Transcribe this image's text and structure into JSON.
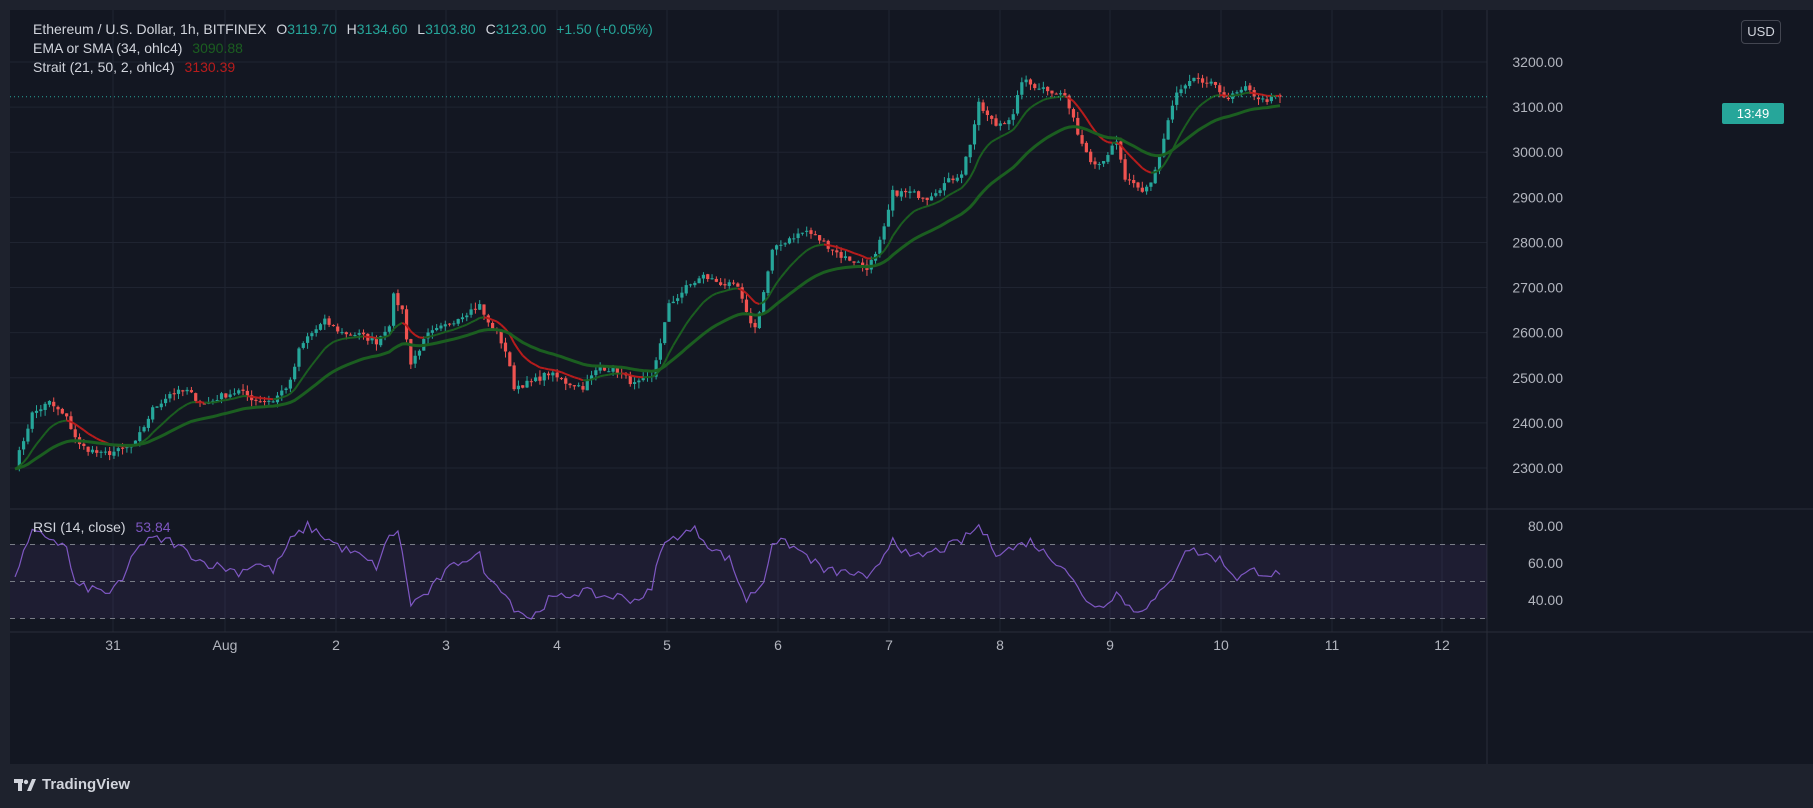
{
  "header": {
    "symbol": "Ethereum / U.S. Dollar, 1h, BITFINEX",
    "o_label": "O",
    "o_value": "3119.70",
    "h_label": "H",
    "h_value": "3134.60",
    "l_label": "L",
    "l_value": "3103.80",
    "c_label": "C",
    "c_value": "3123.00",
    "change": "+1.50 (+0.05%)"
  },
  "indicators": {
    "ema_title": "EMA or SMA (34, ohlc4)",
    "ema_value": "3090.88",
    "strait_title": "Strait (21, 50, 2, ohlc4)",
    "strait_value": "3130.39",
    "rsi_title": "RSI (14, close)",
    "rsi_value": "53.84"
  },
  "currency_label": "USD",
  "countdown": "13:49",
  "branding": {
    "name": "TradingView"
  },
  "colors": {
    "up": "#26a69a",
    "down": "#ef5350",
    "ema": "#1b5e20",
    "strait": "#b71c1c",
    "rsi": "#7e57c2",
    "background": "#131722"
  },
  "chart_data": [
    {
      "type": "candlestick",
      "title": "Ethereum / U.S. Dollar, 1h, BITFINEX",
      "x_ticks": [
        "31",
        "Aug",
        "2",
        "3",
        "4",
        "5",
        "6",
        "7",
        "8",
        "9",
        "10",
        "11",
        "12"
      ],
      "y_ticks": [
        "3200.00",
        "3100.00",
        "3000.00",
        "2900.00",
        "2800.00",
        "2700.00",
        "2600.00",
        "2500.00",
        "2400.00",
        "2300.00"
      ],
      "ylim": [
        2300,
        3200
      ],
      "last_close": 3123.0,
      "price_path": [
        [
          0,
          2305
        ],
        [
          4,
          2420
        ],
        [
          8,
          2445
        ],
        [
          12,
          2410
        ],
        [
          15,
          2350
        ],
        [
          20,
          2330
        ],
        [
          25,
          2340
        ],
        [
          28,
          2355
        ],
        [
          32,
          2430
        ],
        [
          36,
          2465
        ],
        [
          40,
          2470
        ],
        [
          44,
          2440
        ],
        [
          48,
          2460
        ],
        [
          52,
          2470
        ],
        [
          56,
          2450
        ],
        [
          60,
          2450
        ],
        [
          64,
          2490
        ],
        [
          66,
          2560
        ],
        [
          68,
          2590
        ],
        [
          72,
          2625
        ],
        [
          76,
          2600
        ],
        [
          80,
          2595
        ],
        [
          84,
          2580
        ],
        [
          87,
          2620
        ],
        [
          88,
          2680
        ],
        [
          90,
          2650
        ],
        [
          92,
          2530
        ],
        [
          94,
          2565
        ],
        [
          96,
          2595
        ],
        [
          100,
          2615
        ],
        [
          104,
          2640
        ],
        [
          108,
          2660
        ],
        [
          110,
          2620
        ],
        [
          112,
          2600
        ],
        [
          114,
          2560
        ],
        [
          116,
          2480
        ],
        [
          120,
          2490
        ],
        [
          124,
          2510
        ],
        [
          128,
          2490
        ],
        [
          132,
          2480
        ],
        [
          136,
          2525
        ],
        [
          140,
          2515
        ],
        [
          144,
          2485
        ],
        [
          148,
          2500
        ],
        [
          150,
          2580
        ],
        [
          152,
          2660
        ],
        [
          156,
          2700
        ],
        [
          160,
          2725
        ],
        [
          164,
          2710
        ],
        [
          168,
          2700
        ],
        [
          170,
          2640
        ],
        [
          172,
          2610
        ],
        [
          174,
          2690
        ],
        [
          176,
          2780
        ],
        [
          180,
          2810
        ],
        [
          184,
          2825
        ],
        [
          188,
          2800
        ],
        [
          192,
          2770
        ],
        [
          196,
          2755
        ],
        [
          198,
          2745
        ],
        [
          200,
          2770
        ],
        [
          202,
          2830
        ],
        [
          204,
          2910
        ],
        [
          208,
          2910
        ],
        [
          212,
          2900
        ],
        [
          216,
          2930
        ],
        [
          220,
          2955
        ],
        [
          222,
          3020
        ],
        [
          224,
          3105
        ],
        [
          226,
          3080
        ],
        [
          228,
          3060
        ],
        [
          232,
          3080
        ],
        [
          234,
          3160
        ],
        [
          236,
          3150
        ],
        [
          240,
          3140
        ],
        [
          244,
          3125
        ],
        [
          246,
          3070
        ],
        [
          248,
          3020
        ],
        [
          250,
          2985
        ],
        [
          252,
          2975
        ],
        [
          256,
          3020
        ],
        [
          258,
          2940
        ],
        [
          262,
          2910
        ],
        [
          264,
          2935
        ],
        [
          266,
          2990
        ],
        [
          268,
          3070
        ],
        [
          270,
          3130
        ],
        [
          274,
          3160
        ],
        [
          278,
          3150
        ],
        [
          282,
          3120
        ],
        [
          286,
          3140
        ],
        [
          290,
          3115
        ],
        [
          294,
          3123
        ]
      ],
      "series": [
        {
          "name": "EMA or SMA (34, ohlc4)",
          "last": 3090.88
        },
        {
          "name": "Strait (21, 50, 2, ohlc4)",
          "last": 3130.39
        }
      ]
    },
    {
      "type": "line",
      "title": "RSI (14, close)",
      "y_ticks": [
        "80.00",
        "60.00",
        "40.00"
      ],
      "ylim": [
        28,
        85
      ],
      "bands": [
        30,
        50,
        70
      ],
      "last": 53.84,
      "values": [
        [
          0,
          54
        ],
        [
          4,
          76
        ],
        [
          8,
          74
        ],
        [
          12,
          68
        ],
        [
          14,
          48
        ],
        [
          18,
          46
        ],
        [
          22,
          44
        ],
        [
          25,
          50
        ],
        [
          28,
          68
        ],
        [
          32,
          73
        ],
        [
          36,
          72
        ],
        [
          40,
          66
        ],
        [
          44,
          60
        ],
        [
          48,
          58
        ],
        [
          52,
          55
        ],
        [
          56,
          60
        ],
        [
          60,
          56
        ],
        [
          64,
          72
        ],
        [
          68,
          80
        ],
        [
          72,
          74
        ],
        [
          76,
          68
        ],
        [
          80,
          64
        ],
        [
          84,
          58
        ],
        [
          87,
          74
        ],
        [
          89,
          78
        ],
        [
          92,
          38
        ],
        [
          96,
          44
        ],
        [
          100,
          55
        ],
        [
          104,
          62
        ],
        [
          108,
          64
        ],
        [
          110,
          50
        ],
        [
          112,
          50
        ],
        [
          116,
          36
        ],
        [
          120,
          30
        ],
        [
          124,
          40
        ],
        [
          128,
          42
        ],
        [
          132,
          45
        ],
        [
          136,
          42
        ],
        [
          140,
          42
        ],
        [
          144,
          40
        ],
        [
          148,
          45
        ],
        [
          150,
          68
        ],
        [
          154,
          75
        ],
        [
          158,
          78
        ],
        [
          162,
          68
        ],
        [
          166,
          62
        ],
        [
          170,
          40
        ],
        [
          174,
          50
        ],
        [
          176,
          72
        ],
        [
          180,
          70
        ],
        [
          184,
          64
        ],
        [
          188,
          56
        ],
        [
          192,
          55
        ],
        [
          196,
          54
        ],
        [
          198,
          50
        ],
        [
          200,
          56
        ],
        [
          204,
          74
        ],
        [
          208,
          62
        ],
        [
          212,
          65
        ],
        [
          216,
          68
        ],
        [
          220,
          72
        ],
        [
          224,
          80
        ],
        [
          228,
          66
        ],
        [
          232,
          68
        ],
        [
          236,
          72
        ],
        [
          240,
          64
        ],
        [
          244,
          58
        ],
        [
          248,
          42
        ],
        [
          252,
          36
        ],
        [
          256,
          44
        ],
        [
          260,
          34
        ],
        [
          264,
          38
        ],
        [
          268,
          48
        ],
        [
          272,
          68
        ],
        [
          276,
          65
        ],
        [
          280,
          62
        ],
        [
          284,
          52
        ],
        [
          288,
          56
        ],
        [
          292,
          54
        ],
        [
          294,
          53.84
        ]
      ]
    }
  ]
}
